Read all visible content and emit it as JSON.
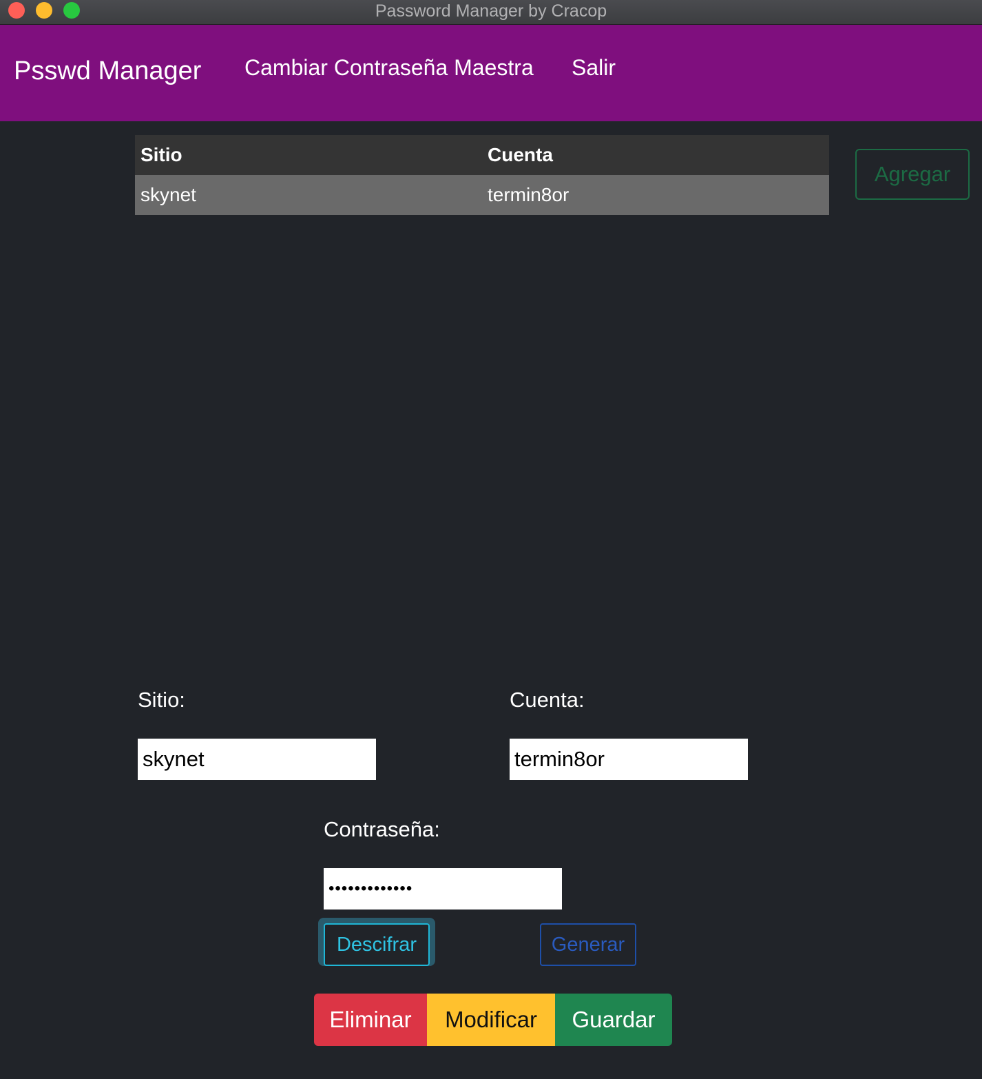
{
  "window": {
    "title": "Password Manager by Cracop"
  },
  "navbar": {
    "brand": "Psswd Manager",
    "links": [
      "Cambiar Contraseña Maestra",
      "Salir"
    ],
    "color": "#7f0f7e"
  },
  "table": {
    "headers": [
      "Sitio",
      "Cuenta"
    ],
    "rows": [
      [
        "skynet",
        "termin8or"
      ]
    ]
  },
  "actions": {
    "add_label": "Agregar"
  },
  "form": {
    "sitio_label": "Sitio:",
    "sitio_value": "skynet",
    "cuenta_label": "Cuenta:",
    "cuenta_value": "termin8or",
    "password_label": "Contraseña:",
    "password_masked": "•••••••••••••",
    "decrypt_label": "Descifrar",
    "generate_label": "Generar"
  },
  "buttons": {
    "delete_label": "Eliminar",
    "modify_label": "Modificar",
    "save_label": "Guardar",
    "colors": {
      "delete": "#dc3545",
      "modify": "#ffc12e",
      "save": "#1f8650"
    }
  }
}
